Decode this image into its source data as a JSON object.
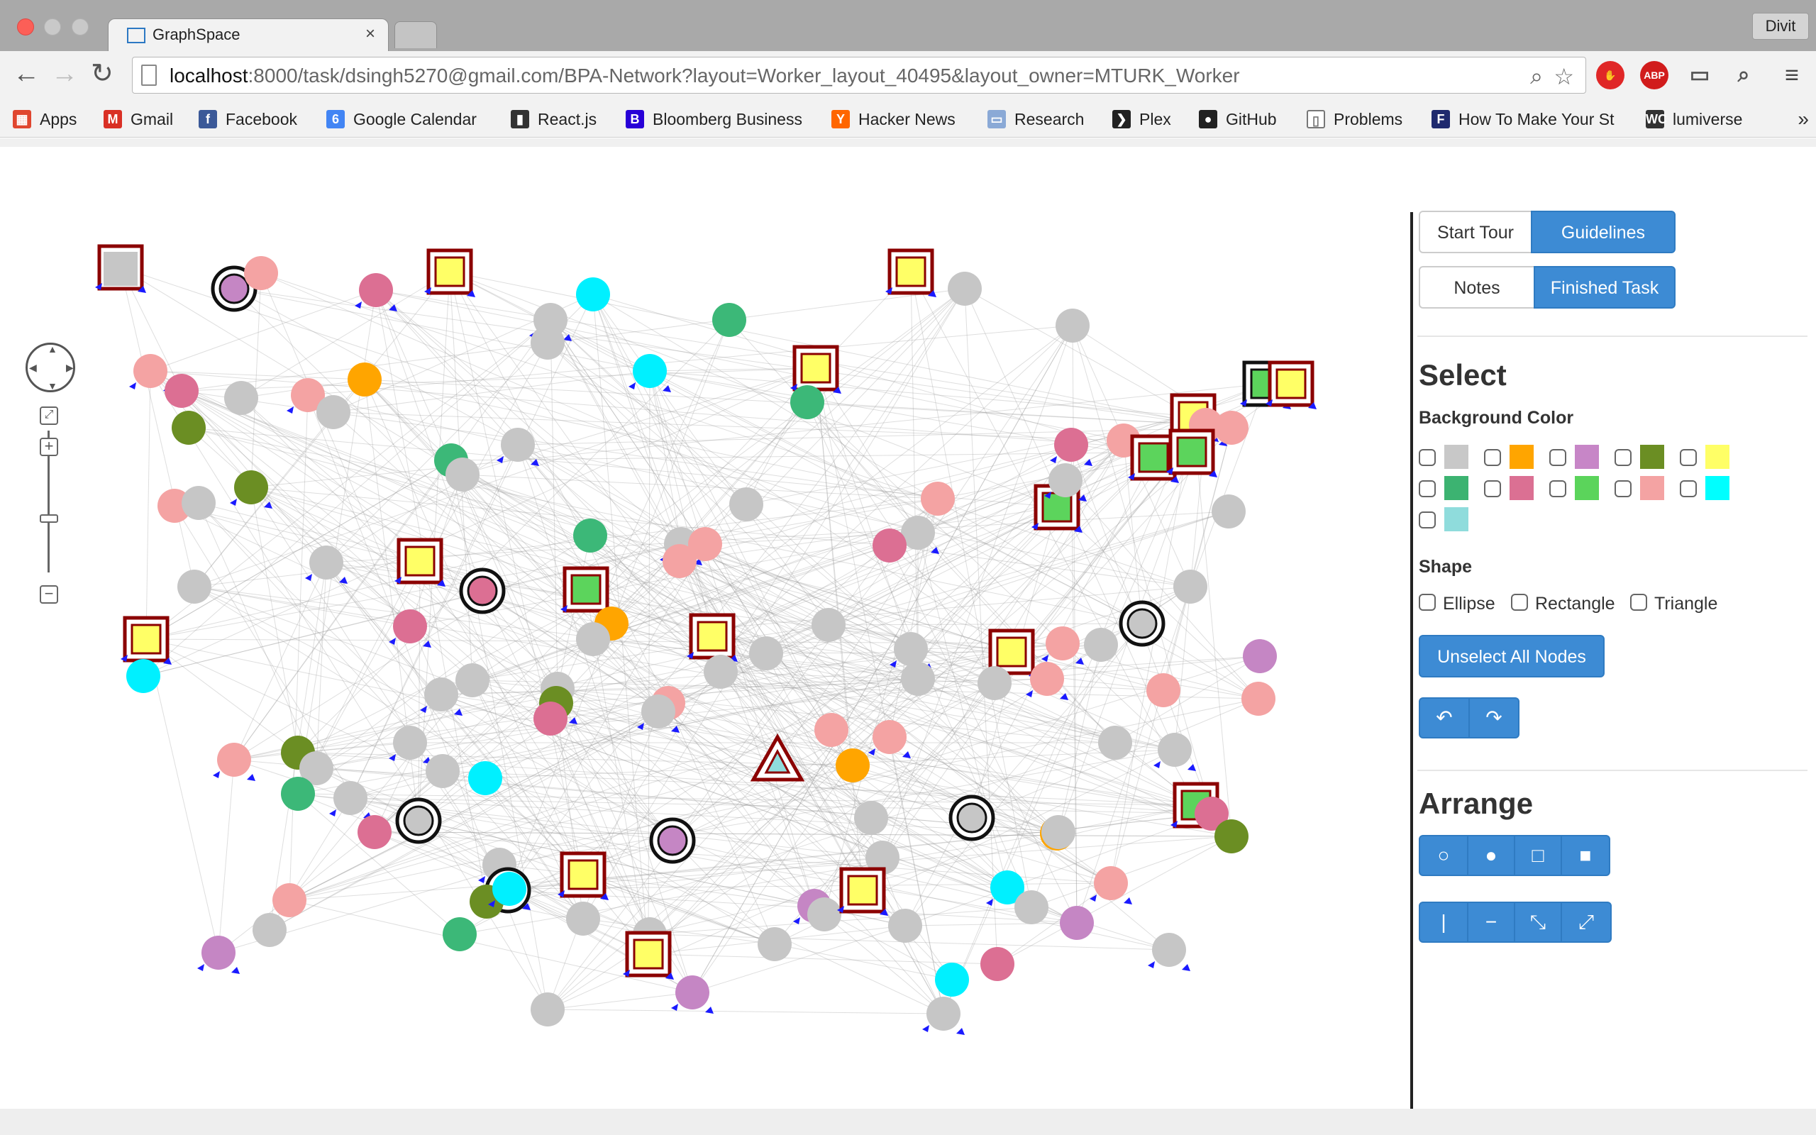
{
  "browser": {
    "tab_title": "GraphSpace",
    "tab_close": "×",
    "profile": "Divit",
    "url_host": "localhost",
    "url_rest": ":8000/task/dsingh5270@gmail.com/BPA-Network?layout=Worker_layout_40495&layout_owner=MTURK_Worker",
    "ext_abp": "ABP",
    "bookmarks_more": "»",
    "bookmarks": [
      {
        "label": "Apps",
        "icon": "apps-grid-icon",
        "color": "#e0462f"
      },
      {
        "label": "Gmail",
        "icon": "gmail-icon",
        "color": "#d93025"
      },
      {
        "label": "Facebook",
        "icon": "facebook-icon",
        "color": "#3b5998"
      },
      {
        "label": "Google Calendar",
        "icon": "calendar-icon",
        "color": "#4285f4"
      },
      {
        "label": "React.js",
        "icon": "react-icon",
        "color": "#333333"
      },
      {
        "label": "Bloomberg Business",
        "icon": "bloomberg-icon",
        "color": "#2800d7"
      },
      {
        "label": "Hacker News",
        "icon": "hacker-news-icon",
        "color": "#ff6600"
      },
      {
        "label": "Research",
        "icon": "folder-icon",
        "color": "#8aa9d6"
      },
      {
        "label": "Plex",
        "icon": "plex-icon",
        "color": "#222222"
      },
      {
        "label": "GitHub",
        "icon": "github-icon",
        "color": "#222222"
      },
      {
        "label": "Problems",
        "icon": "page-icon",
        "color": "#ffffff"
      },
      {
        "label": "How To Make Your St",
        "icon": "f-icon",
        "color": "#1f2a6e"
      },
      {
        "label": "lumiverse",
        "icon": "wc-icon",
        "color": "#333333"
      }
    ],
    "bookmark_glyphs": [
      "▦",
      "M",
      "f",
      "6",
      "▮",
      "B",
      "Y",
      "▭",
      "❯",
      "●",
      "▯",
      "F",
      "WC"
    ]
  },
  "panel": {
    "start_tour": "Start Tour",
    "guidelines": "Guidelines",
    "notes": "Notes",
    "finished_task": "Finished Task",
    "select_heading": "Select",
    "bg_color_heading": "Background Color",
    "bg_colors": [
      "#c8c8c8",
      "#ffa500",
      "#c786c7",
      "#6b8e23",
      "#ffff66",
      "#3cb371",
      "#db7093",
      "#5bd45b",
      "#f4a3a3",
      "#00ffff",
      "#8fdcdc"
    ],
    "shape_heading": "Shape",
    "shapes": [
      "Ellipse",
      "Rectangle",
      "Triangle"
    ],
    "unselect_all": "Unselect All Nodes",
    "arrange_heading": "Arrange"
  },
  "graph": {
    "colors": {
      "gray": "#c6c6c6",
      "pink": "#f4a3a3",
      "rose": "#dc6f93",
      "green": "#3cb878",
      "olive": "#6b8e23",
      "orange": "#ffa500",
      "cyan": "#00f0ff",
      "violet": "#c586c4",
      "yellow": "#ffff66",
      "lgreen": "#5cd45c",
      "darkred": "#8b0000",
      "edge": "#999999",
      "arrow": "#1a1aff"
    }
  }
}
